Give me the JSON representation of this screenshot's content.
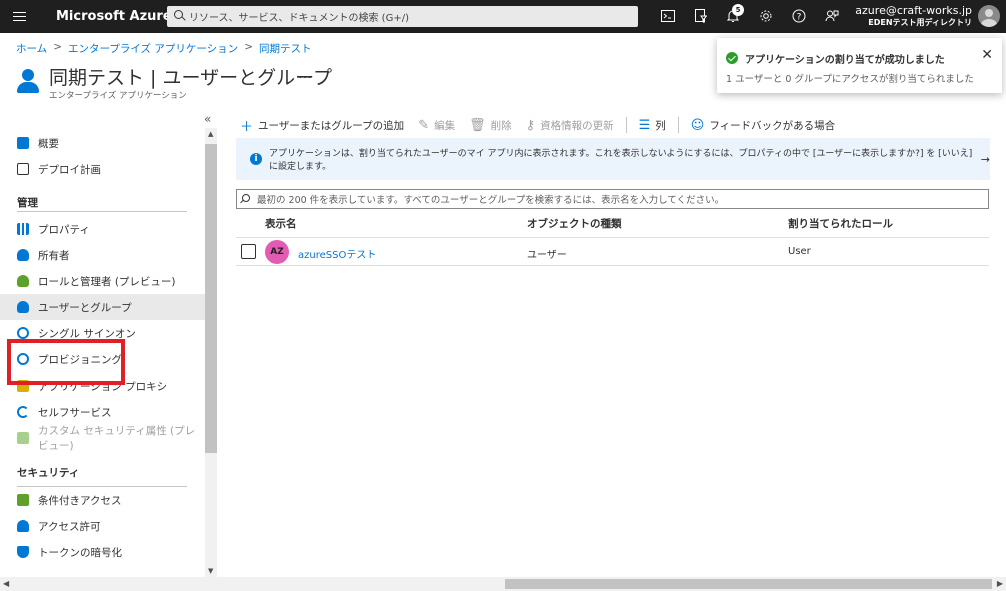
{
  "topbar": {
    "brand": "Microsoft Azure",
    "search_placeholder": "リソース、サービス、ドキュメントの検索 (G+/)",
    "notification_count": "5",
    "account_email": "azure@craft-works.jp",
    "account_directory": "EDENテスト用ディレクトリ"
  },
  "breadcrumb": {
    "home": "ホーム",
    "enterprise_apps": "エンタープライズ アプリケーション",
    "app": "同期テスト",
    "sep": ">"
  },
  "header": {
    "title": "同期テスト | ユーザーとグループ",
    "more": "…",
    "subtitle": "エンタープライズ アプリケーション"
  },
  "toast": {
    "title": "アプリケーションの割り当てが成功しました",
    "message": "1 ユーザーと 0 グループにアクセスが割り当てられました",
    "close": "✕"
  },
  "sidebar": {
    "collapse": "«",
    "items_top": [
      {
        "label": "概要",
        "color": "#0078d4"
      },
      {
        "label": "デプロイ計画",
        "color": "#323130"
      }
    ],
    "section_manage": "管理",
    "items_manage": [
      {
        "label": "プロパティ",
        "color": "#0078d4"
      },
      {
        "label": "所有者",
        "color": "#0078d4"
      },
      {
        "label": "ロールと管理者 (プレビュー)",
        "color": "#5ea12a"
      },
      {
        "label": "ユーザーとグループ",
        "color": "#0078d4"
      },
      {
        "label": "シングル サインオン",
        "color": "#0078d4"
      },
      {
        "label": "プロビジョニング",
        "color": "#0078d4"
      },
      {
        "label": "アプリケーション プロキシ",
        "color": "#d6b300"
      },
      {
        "label": "セルフサービス",
        "color": "#0078d4"
      },
      {
        "label": "カスタム セキュリティ属性 (プレビュー)",
        "color": "#a8d08d"
      }
    ],
    "section_security": "セキュリティ",
    "items_security": [
      {
        "label": "条件付きアクセス",
        "color": "#5ea12a"
      },
      {
        "label": "アクセス許可",
        "color": "#0078d4"
      },
      {
        "label": "トークンの暗号化",
        "color": "#0078d4"
      }
    ]
  },
  "toolbar": {
    "add": "ユーザーまたはグループの追加",
    "edit": "編集",
    "delete": "削除",
    "update_credentials": "資格情報の更新",
    "columns": "列",
    "feedback": "フィードバックがある場合"
  },
  "info": {
    "text": "アプリケーションは、割り当てられたユーザーのマイ アプリ内に表示されます。これを表示しないようにするには、プロパティの中で [ユーザーに表示しますか?] を [いいえ] に設定します。",
    "arrow": "→"
  },
  "filter": {
    "placeholder": "最初の 200 件を表示しています。すべてのユーザーとグループを検索するには、表示名を入力してください。"
  },
  "table": {
    "columns": [
      "表示名",
      "オブジェクトの種類",
      "割り当てられたロール"
    ],
    "rows": [
      {
        "initials": "AZ",
        "name": "azureSSOテスト",
        "type": "ユーザー",
        "role": "User"
      }
    ]
  }
}
